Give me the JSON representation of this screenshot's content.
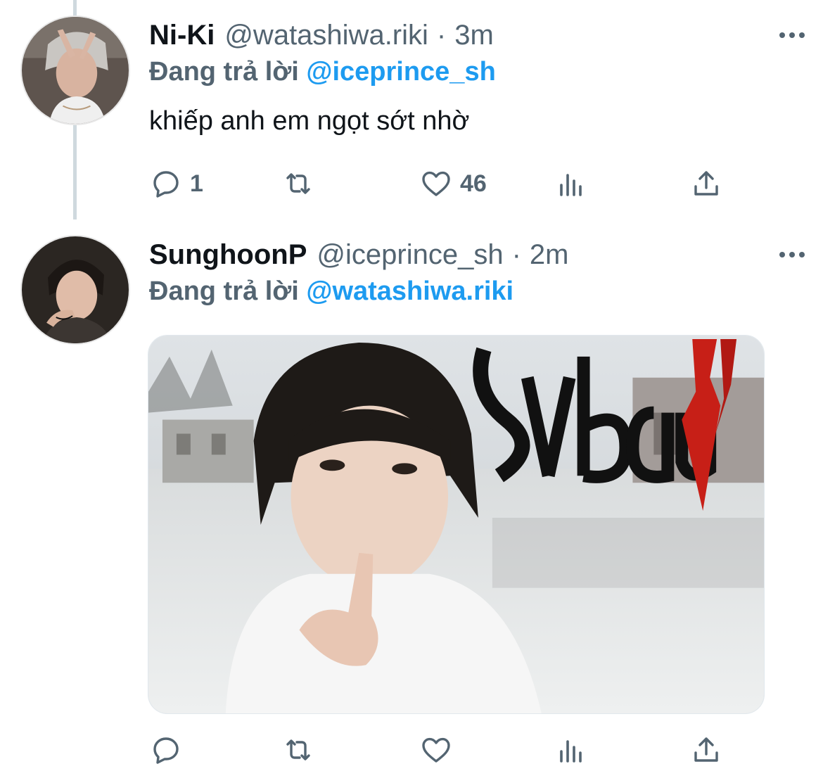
{
  "tweets": [
    {
      "name": "Ni-Ki",
      "handle": "@watashiwa.riki",
      "separator": "·",
      "time": "3m",
      "reply_prefix": "Đang trả lời",
      "reply_to": "@iceprince_sh",
      "text": "khiếp anh em ngọt sớt nhờ",
      "reply_count": "1",
      "like_count": "46"
    },
    {
      "name": "SunghoonP",
      "handle": "@iceprince_sh",
      "separator": "·",
      "time": "2m",
      "reply_prefix": "Đang trả lời",
      "reply_to": "@watashiwa.riki",
      "media_caption": "Sybau"
    }
  ],
  "icons": {
    "more": "more-horizontal-icon",
    "reply": "reply-icon",
    "retweet": "retweet-icon",
    "like": "heart-icon",
    "views": "views-icon",
    "share": "share-icon"
  },
  "colors": {
    "accent": "#1d9bf0",
    "secondary_text": "#536471",
    "primary_text": "#0f1419",
    "thread_line": "#cfd9de"
  }
}
